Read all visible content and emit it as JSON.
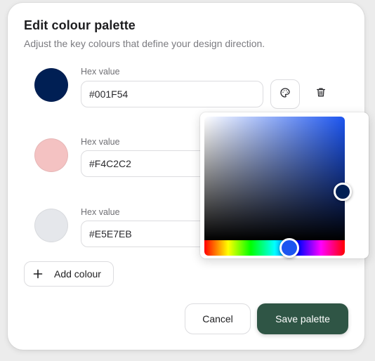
{
  "dialog": {
    "title": "Edit colour palette",
    "subtitle": "Adjust the key colours that define your design direction."
  },
  "colours": [
    {
      "label": "Hex value",
      "hex": "#001F54",
      "swatch": "#001F54"
    },
    {
      "label": "Hex value",
      "hex": "#F4C2C2",
      "swatch": "#F4C2C2"
    },
    {
      "label": "Hex value",
      "hex": "#E5E7EB",
      "swatch": "#E5E7EB"
    }
  ],
  "icons": {
    "picker": "palette-icon",
    "delete": "trash-icon",
    "add": "plus-icon"
  },
  "actions": {
    "add_label": "Add colour",
    "cancel_label": "Cancel",
    "save_label": "Save palette"
  },
  "picker": {
    "selected_hex": "#001F54",
    "base_hue_hex": "#1C55F0"
  },
  "theme": {
    "accent": "#2F5545",
    "border": "#DCDCDF"
  }
}
